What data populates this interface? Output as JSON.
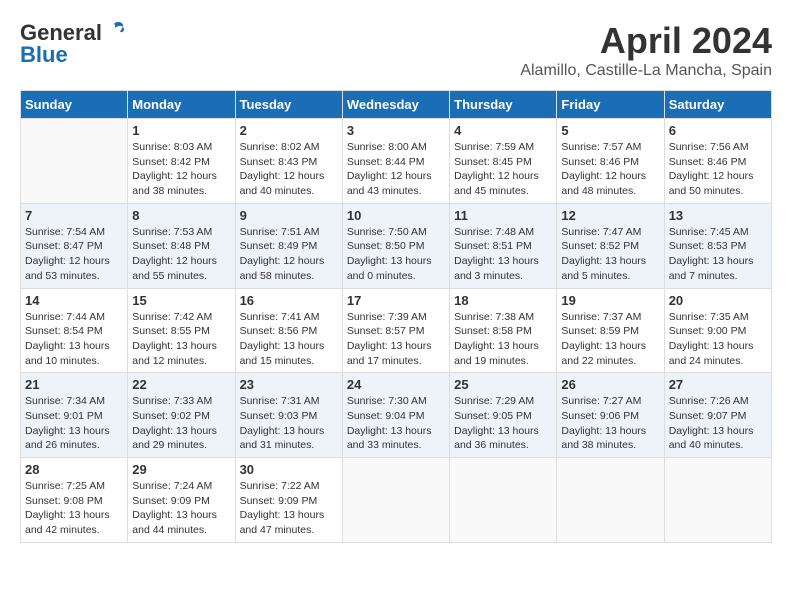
{
  "header": {
    "logo_general": "General",
    "logo_blue": "Blue",
    "month_title": "April 2024",
    "location": "Alamillo, Castille-La Mancha, Spain"
  },
  "days_of_week": [
    "Sunday",
    "Monday",
    "Tuesday",
    "Wednesday",
    "Thursday",
    "Friday",
    "Saturday"
  ],
  "weeks": [
    [
      {
        "day": "",
        "sunrise": "",
        "sunset": "",
        "daylight": ""
      },
      {
        "day": "1",
        "sunrise": "Sunrise: 8:03 AM",
        "sunset": "Sunset: 8:42 PM",
        "daylight": "Daylight: 12 hours and 38 minutes."
      },
      {
        "day": "2",
        "sunrise": "Sunrise: 8:02 AM",
        "sunset": "Sunset: 8:43 PM",
        "daylight": "Daylight: 12 hours and 40 minutes."
      },
      {
        "day": "3",
        "sunrise": "Sunrise: 8:00 AM",
        "sunset": "Sunset: 8:44 PM",
        "daylight": "Daylight: 12 hours and 43 minutes."
      },
      {
        "day": "4",
        "sunrise": "Sunrise: 7:59 AM",
        "sunset": "Sunset: 8:45 PM",
        "daylight": "Daylight: 12 hours and 45 minutes."
      },
      {
        "day": "5",
        "sunrise": "Sunrise: 7:57 AM",
        "sunset": "Sunset: 8:46 PM",
        "daylight": "Daylight: 12 hours and 48 minutes."
      },
      {
        "day": "6",
        "sunrise": "Sunrise: 7:56 AM",
        "sunset": "Sunset: 8:46 PM",
        "daylight": "Daylight: 12 hours and 50 minutes."
      }
    ],
    [
      {
        "day": "7",
        "sunrise": "Sunrise: 7:54 AM",
        "sunset": "Sunset: 8:47 PM",
        "daylight": "Daylight: 12 hours and 53 minutes."
      },
      {
        "day": "8",
        "sunrise": "Sunrise: 7:53 AM",
        "sunset": "Sunset: 8:48 PM",
        "daylight": "Daylight: 12 hours and 55 minutes."
      },
      {
        "day": "9",
        "sunrise": "Sunrise: 7:51 AM",
        "sunset": "Sunset: 8:49 PM",
        "daylight": "Daylight: 12 hours and 58 minutes."
      },
      {
        "day": "10",
        "sunrise": "Sunrise: 7:50 AM",
        "sunset": "Sunset: 8:50 PM",
        "daylight": "Daylight: 13 hours and 0 minutes."
      },
      {
        "day": "11",
        "sunrise": "Sunrise: 7:48 AM",
        "sunset": "Sunset: 8:51 PM",
        "daylight": "Daylight: 13 hours and 3 minutes."
      },
      {
        "day": "12",
        "sunrise": "Sunrise: 7:47 AM",
        "sunset": "Sunset: 8:52 PM",
        "daylight": "Daylight: 13 hours and 5 minutes."
      },
      {
        "day": "13",
        "sunrise": "Sunrise: 7:45 AM",
        "sunset": "Sunset: 8:53 PM",
        "daylight": "Daylight: 13 hours and 7 minutes."
      }
    ],
    [
      {
        "day": "14",
        "sunrise": "Sunrise: 7:44 AM",
        "sunset": "Sunset: 8:54 PM",
        "daylight": "Daylight: 13 hours and 10 minutes."
      },
      {
        "day": "15",
        "sunrise": "Sunrise: 7:42 AM",
        "sunset": "Sunset: 8:55 PM",
        "daylight": "Daylight: 13 hours and 12 minutes."
      },
      {
        "day": "16",
        "sunrise": "Sunrise: 7:41 AM",
        "sunset": "Sunset: 8:56 PM",
        "daylight": "Daylight: 13 hours and 15 minutes."
      },
      {
        "day": "17",
        "sunrise": "Sunrise: 7:39 AM",
        "sunset": "Sunset: 8:57 PM",
        "daylight": "Daylight: 13 hours and 17 minutes."
      },
      {
        "day": "18",
        "sunrise": "Sunrise: 7:38 AM",
        "sunset": "Sunset: 8:58 PM",
        "daylight": "Daylight: 13 hours and 19 minutes."
      },
      {
        "day": "19",
        "sunrise": "Sunrise: 7:37 AM",
        "sunset": "Sunset: 8:59 PM",
        "daylight": "Daylight: 13 hours and 22 minutes."
      },
      {
        "day": "20",
        "sunrise": "Sunrise: 7:35 AM",
        "sunset": "Sunset: 9:00 PM",
        "daylight": "Daylight: 13 hours and 24 minutes."
      }
    ],
    [
      {
        "day": "21",
        "sunrise": "Sunrise: 7:34 AM",
        "sunset": "Sunset: 9:01 PM",
        "daylight": "Daylight: 13 hours and 26 minutes."
      },
      {
        "day": "22",
        "sunrise": "Sunrise: 7:33 AM",
        "sunset": "Sunset: 9:02 PM",
        "daylight": "Daylight: 13 hours and 29 minutes."
      },
      {
        "day": "23",
        "sunrise": "Sunrise: 7:31 AM",
        "sunset": "Sunset: 9:03 PM",
        "daylight": "Daylight: 13 hours and 31 minutes."
      },
      {
        "day": "24",
        "sunrise": "Sunrise: 7:30 AM",
        "sunset": "Sunset: 9:04 PM",
        "daylight": "Daylight: 13 hours and 33 minutes."
      },
      {
        "day": "25",
        "sunrise": "Sunrise: 7:29 AM",
        "sunset": "Sunset: 9:05 PM",
        "daylight": "Daylight: 13 hours and 36 minutes."
      },
      {
        "day": "26",
        "sunrise": "Sunrise: 7:27 AM",
        "sunset": "Sunset: 9:06 PM",
        "daylight": "Daylight: 13 hours and 38 minutes."
      },
      {
        "day": "27",
        "sunrise": "Sunrise: 7:26 AM",
        "sunset": "Sunset: 9:07 PM",
        "daylight": "Daylight: 13 hours and 40 minutes."
      }
    ],
    [
      {
        "day": "28",
        "sunrise": "Sunrise: 7:25 AM",
        "sunset": "Sunset: 9:08 PM",
        "daylight": "Daylight: 13 hours and 42 minutes."
      },
      {
        "day": "29",
        "sunrise": "Sunrise: 7:24 AM",
        "sunset": "Sunset: 9:09 PM",
        "daylight": "Daylight: 13 hours and 44 minutes."
      },
      {
        "day": "30",
        "sunrise": "Sunrise: 7:22 AM",
        "sunset": "Sunset: 9:09 PM",
        "daylight": "Daylight: 13 hours and 47 minutes."
      },
      {
        "day": "",
        "sunrise": "",
        "sunset": "",
        "daylight": ""
      },
      {
        "day": "",
        "sunrise": "",
        "sunset": "",
        "daylight": ""
      },
      {
        "day": "",
        "sunrise": "",
        "sunset": "",
        "daylight": ""
      },
      {
        "day": "",
        "sunrise": "",
        "sunset": "",
        "daylight": ""
      }
    ]
  ]
}
